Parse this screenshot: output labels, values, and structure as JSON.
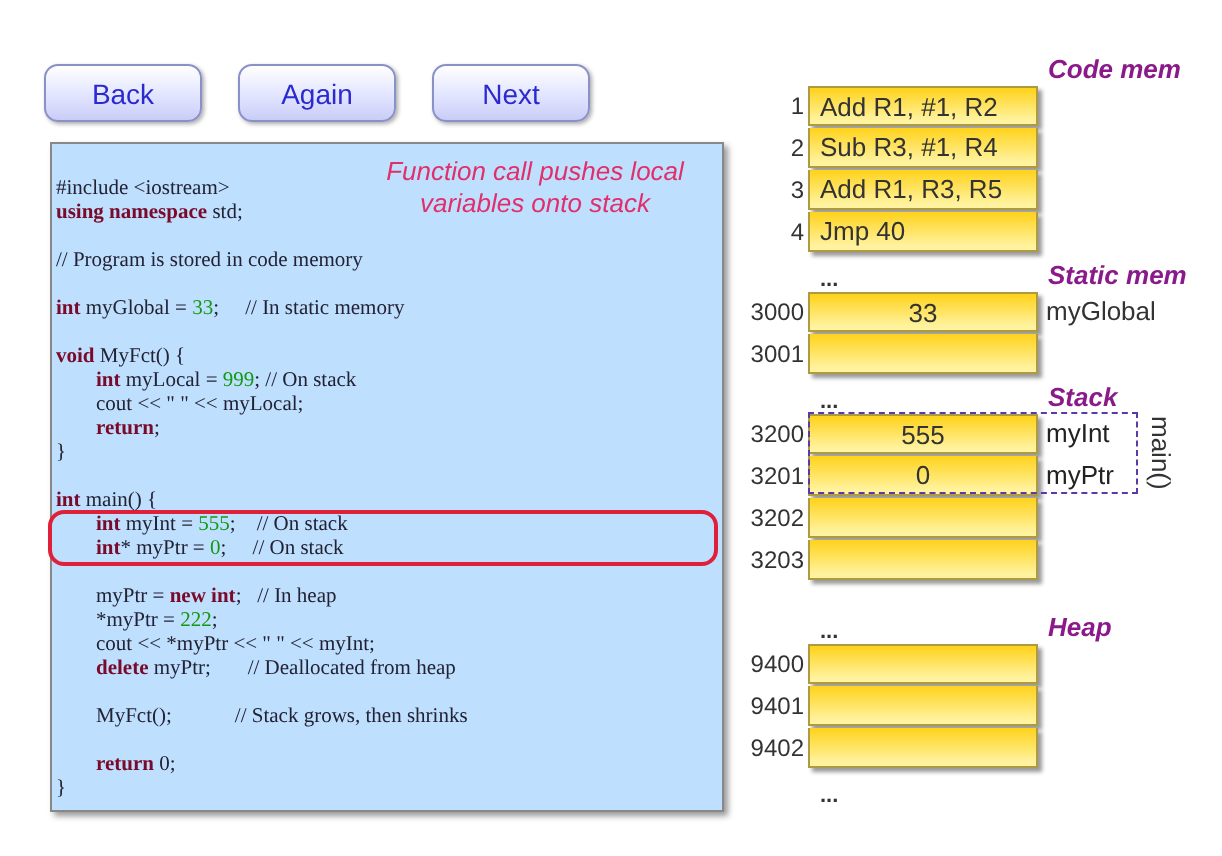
{
  "buttons": [
    {
      "label": "Back"
    },
    {
      "label": "Again"
    },
    {
      "label": "Next"
    }
  ],
  "code_panel": {
    "note": "Function call pushes local variables onto stack",
    "blocks": [
      {
        "highlighted": false,
        "lines": [
          {
            "kind": "code",
            "indented": false,
            "tokens": [
              {
                "kind": "t",
                "text": "#include <iostream>"
              }
            ]
          },
          {
            "kind": "code",
            "indented": false,
            "tokens": [
              {
                "kind": "kw",
                "text": "using namespace"
              },
              {
                "kind": "t",
                "text": " std;"
              }
            ]
          },
          {
            "kind": "blank"
          },
          {
            "kind": "code",
            "indented": false,
            "tokens": [
              {
                "kind": "t",
                "text": "// Program is stored in code memory"
              }
            ]
          },
          {
            "kind": "blank"
          },
          {
            "kind": "code",
            "indented": false,
            "tokens": [
              {
                "kind": "kw",
                "text": "int"
              },
              {
                "kind": "t",
                "text": " myGlobal = "
              },
              {
                "kind": "num",
                "text": "33"
              },
              {
                "kind": "t",
                "text": ";     // In static memory"
              }
            ]
          },
          {
            "kind": "blank"
          },
          {
            "kind": "code",
            "indented": false,
            "tokens": [
              {
                "kind": "kw",
                "text": "void"
              },
              {
                "kind": "t",
                "text": " MyFct() {"
              }
            ]
          },
          {
            "kind": "code",
            "indented": true,
            "tokens": [
              {
                "kind": "kw",
                "text": "int"
              },
              {
                "kind": "t",
                "text": " myLocal = "
              },
              {
                "kind": "num",
                "text": "999"
              },
              {
                "kind": "t",
                "text": "; // On stack"
              }
            ]
          },
          {
            "kind": "code",
            "indented": true,
            "tokens": [
              {
                "kind": "t",
                "text": "cout << \" \" << myLocal;"
              }
            ]
          },
          {
            "kind": "code",
            "indented": true,
            "tokens": [
              {
                "kind": "kw",
                "text": "return"
              },
              {
                "kind": "t",
                "text": ";"
              }
            ]
          },
          {
            "kind": "code",
            "indented": false,
            "tokens": [
              {
                "kind": "t",
                "text": "}"
              }
            ]
          },
          {
            "kind": "blank"
          },
          {
            "kind": "code",
            "indented": false,
            "tokens": [
              {
                "kind": "kw",
                "text": "int"
              },
              {
                "kind": "t",
                "text": " main() {"
              }
            ]
          }
        ]
      },
      {
        "highlighted": true,
        "lines": [
          {
            "kind": "code",
            "indented": true,
            "tokens": [
              {
                "kind": "kw",
                "text": "int"
              },
              {
                "kind": "t",
                "text": " myInt = "
              },
              {
                "kind": "num",
                "text": "555"
              },
              {
                "kind": "t",
                "text": ";    // On stack"
              }
            ]
          },
          {
            "kind": "code",
            "indented": true,
            "tokens": [
              {
                "kind": "kw",
                "text": "int"
              },
              {
                "kind": "t",
                "text": "* myPtr = "
              },
              {
                "kind": "num",
                "text": "0"
              },
              {
                "kind": "t",
                "text": ";     // On stack"
              }
            ]
          }
        ]
      },
      {
        "highlighted": false,
        "lines": [
          {
            "kind": "blank"
          },
          {
            "kind": "code",
            "indented": true,
            "tokens": [
              {
                "kind": "t",
                "text": "myPtr = "
              },
              {
                "kind": "kw",
                "text": "new int"
              },
              {
                "kind": "t",
                "text": ";   // In heap"
              }
            ]
          },
          {
            "kind": "code",
            "indented": true,
            "tokens": [
              {
                "kind": "t",
                "text": "*myPtr = "
              },
              {
                "kind": "num",
                "text": "222"
              },
              {
                "kind": "t",
                "text": ";"
              }
            ]
          },
          {
            "kind": "code",
            "indented": true,
            "tokens": [
              {
                "kind": "t",
                "text": "cout << *myPtr << \" \" << myInt;"
              }
            ]
          },
          {
            "kind": "code",
            "indented": true,
            "tokens": [
              {
                "kind": "kw",
                "text": "delete"
              },
              {
                "kind": "t",
                "text": " myPtr;       // Deallocated from heap"
              }
            ]
          },
          {
            "kind": "blank"
          },
          {
            "kind": "code",
            "indented": true,
            "tokens": [
              {
                "kind": "t",
                "text": "MyFct();            // Stack grows, then shrinks"
              }
            ]
          },
          {
            "kind": "blank"
          },
          {
            "kind": "code",
            "indented": true,
            "tokens": [
              {
                "kind": "kw",
                "text": "return"
              },
              {
                "kind": "t",
                "text": " 0;"
              }
            ]
          },
          {
            "kind": "code",
            "indented": false,
            "tokens": [
              {
                "kind": "t",
                "text": "}"
              }
            ]
          }
        ]
      }
    ]
  },
  "memory": {
    "sections": [
      {
        "kind": "code",
        "title": "Code mem",
        "rows": [
          {
            "address": "1",
            "value": "Add R1, #1, R2"
          },
          {
            "address": "2",
            "value": "Sub R3, #1, R4"
          },
          {
            "address": "3",
            "value": "Add R1, R3, R5"
          },
          {
            "address": "4",
            "value": "Jmp 40"
          }
        ]
      },
      {
        "kind": "data",
        "lead": "...",
        "title": "Static mem",
        "rows": [
          {
            "address": "3000",
            "value": "33",
            "name": "myGlobal"
          },
          {
            "address": "3001"
          }
        ]
      },
      {
        "kind": "data",
        "lead": "...",
        "title": "Stack",
        "frame_label": "main()",
        "rows": [
          {
            "address": "3200",
            "value": "555",
            "name": "myInt",
            "in_frame": true
          },
          {
            "address": "3201",
            "value": "0",
            "name": "myPtr",
            "in_frame": true
          },
          {
            "address": "3202",
            "in_frame": false
          },
          {
            "address": "3203",
            "in_frame": false
          }
        ]
      },
      {
        "kind": "data",
        "lead": "...",
        "title": "Heap",
        "trail": "...",
        "rows": [
          {
            "address": "9400"
          },
          {
            "address": "9401"
          },
          {
            "address": "9402"
          }
        ]
      }
    ]
  }
}
